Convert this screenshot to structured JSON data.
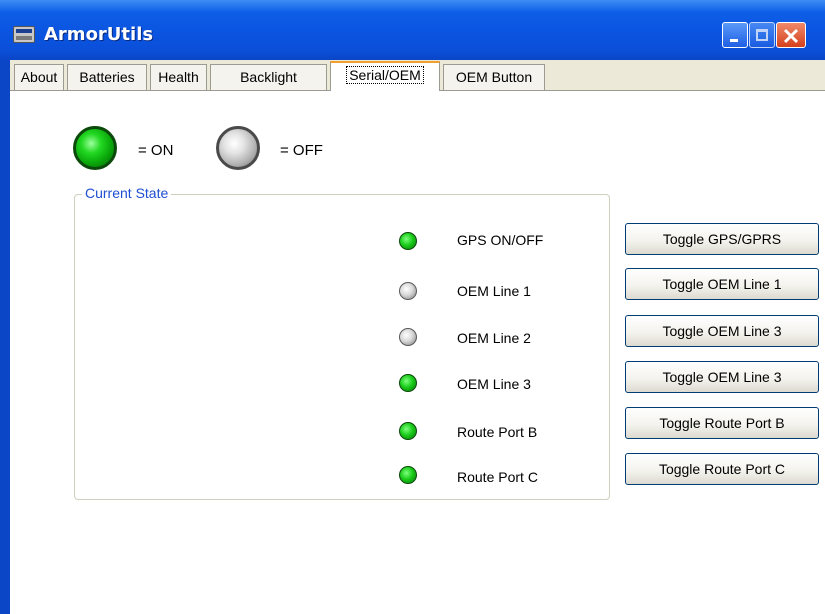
{
  "window": {
    "title": "ArmorUtils"
  },
  "tabs": [
    {
      "label": "About"
    },
    {
      "label": "Batteries"
    },
    {
      "label": "Health"
    },
    {
      "label": "Backlight"
    },
    {
      "label": "Serial/OEM",
      "active": true
    },
    {
      "label": "OEM Button"
    }
  ],
  "legend": {
    "on_text": "= ON",
    "off_text": "= OFF"
  },
  "group": {
    "label": "Current State"
  },
  "states": [
    {
      "label": "GPS ON/OFF",
      "on": true
    },
    {
      "label": "OEM Line 1",
      "on": false
    },
    {
      "label": "OEM Line 2",
      "on": false
    },
    {
      "label": "OEM Line 3",
      "on": true
    },
    {
      "label": "Route Port B",
      "on": true
    },
    {
      "label": "Route Port C",
      "on": true
    }
  ],
  "buttons": [
    {
      "label": "Toggle GPS/GPRS"
    },
    {
      "label": "Toggle OEM Line 1"
    },
    {
      "label": "Toggle OEM Line 3"
    },
    {
      "label": "Toggle OEM Line 3"
    },
    {
      "label": "Toggle Route Port B"
    },
    {
      "label": "Toggle Route Port C"
    }
  ],
  "colors": {
    "titlebar": "#0a54e0",
    "group_label": "#1f4fd2",
    "led_on": "#1acc1a",
    "led_off": "#d8d8d8"
  }
}
